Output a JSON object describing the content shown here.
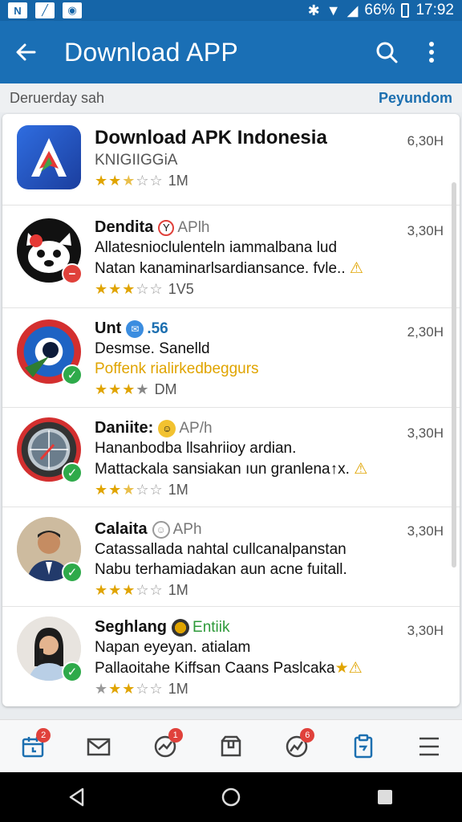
{
  "status_bar": {
    "battery": "66%",
    "time": "17:92"
  },
  "app_bar": {
    "title": "Download APP"
  },
  "subheader": {
    "date": "Deruerday sah",
    "link": "Peyundom"
  },
  "apps": [
    {
      "title": "Download APK Indonesia",
      "tag": "",
      "lines": [
        "KNIGIIGGiA"
      ],
      "rating_stars": 2.5,
      "rating_text": "1M",
      "time": "6,30H",
      "badge": "",
      "icon": "apk-logo-icon"
    },
    {
      "title": "Dendita",
      "tag": "APlh",
      "lines": [
        "Allatesnioclulenteln iammalbana lud",
        "Natan kanaminarlsardiansance. fvle.."
      ],
      "rating_stars": 3,
      "rating_text": "1V5",
      "time": "3,30H",
      "badge": "red",
      "icon": "panda-icon"
    },
    {
      "title": "Unt",
      "tag": ".56",
      "lines": [
        "Desmse. Sanelld",
        "Poffenk rialirkedbeggurs"
      ],
      "rating_stars": 3.5,
      "rating_text": "DM",
      "time": "2,30H",
      "badge": "green",
      "icon": "eye-logo-icon"
    },
    {
      "title": "Daniite:",
      "tag": "AP/h",
      "lines": [
        "Hananbodba llsahriioy ardian.",
        "Mattackala sansiakan ıun granlena↑x."
      ],
      "rating_stars": 2.5,
      "rating_text": "1M",
      "time": "3,30H",
      "badge": "green",
      "icon": "compass-icon"
    },
    {
      "title": "Calaita",
      "tag": "APh",
      "lines": [
        "Catassallada nahtal cullcanalpanstan",
        "Nabu terhamiadakan aun acne fuitall."
      ],
      "rating_stars": 3,
      "rating_text": "1M",
      "time": "3,30H",
      "badge": "green",
      "icon": "man-avatar"
    },
    {
      "title": "Seghlang",
      "tag": "Entiik",
      "lines": [
        "Napan eyeyan. atialam",
        "Pallaoitahe Kiffsan Caans Paslcaka"
      ],
      "rating_stars": 2.5,
      "rating_text": "1M",
      "time": "3,30H",
      "badge": "green",
      "icon": "woman-avatar"
    }
  ],
  "bottom_nav": [
    {
      "icon": "calendar-icon",
      "badge": "2"
    },
    {
      "icon": "mail-icon",
      "badge": ""
    },
    {
      "icon": "activity-icon",
      "badge": "1"
    },
    {
      "icon": "box-icon",
      "badge": ""
    },
    {
      "icon": "stats-icon",
      "badge": "6"
    },
    {
      "icon": "clipboard-icon",
      "badge": ""
    },
    {
      "icon": "menu-icon",
      "badge": ""
    }
  ],
  "colors": {
    "primary": "#1a6fb5",
    "star": "#e0a400",
    "ok": "#2eaa4a",
    "alert": "#e0413b"
  }
}
